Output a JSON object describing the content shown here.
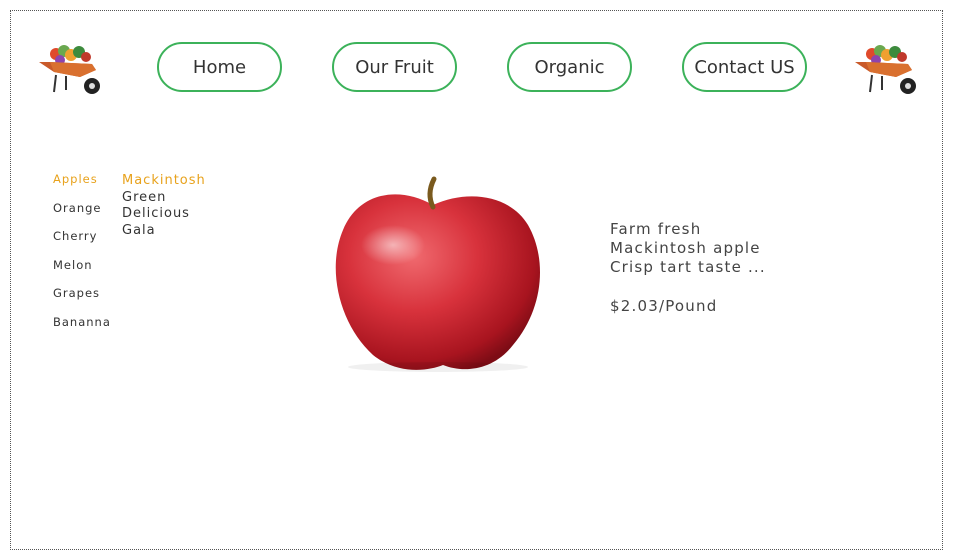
{
  "nav": {
    "home": "Home",
    "our_fruit": "Our Fruit",
    "organic": "Organic",
    "contact": "Contact US"
  },
  "fruits": {
    "items": [
      "Apples",
      "Orange",
      "Cherry",
      "Melon",
      "Grapes",
      "Bananna"
    ],
    "selected": "Apples"
  },
  "varieties": {
    "items": [
      "Mackintosh",
      "Green",
      "Delicious",
      "Gala"
    ],
    "selected": "Mackintosh"
  },
  "product": {
    "line1": "Farm fresh",
    "line2": "Mackintosh apple",
    "line3": "Crisp tart taste ...",
    "price": "$2.03/Pound"
  },
  "colors": {
    "accent_green": "#3cb25a",
    "active_orange": "#e8a21c"
  },
  "icons": {
    "logo": "wheelbarrow-of-vegetables-icon",
    "product_image": "red-apple-image"
  }
}
